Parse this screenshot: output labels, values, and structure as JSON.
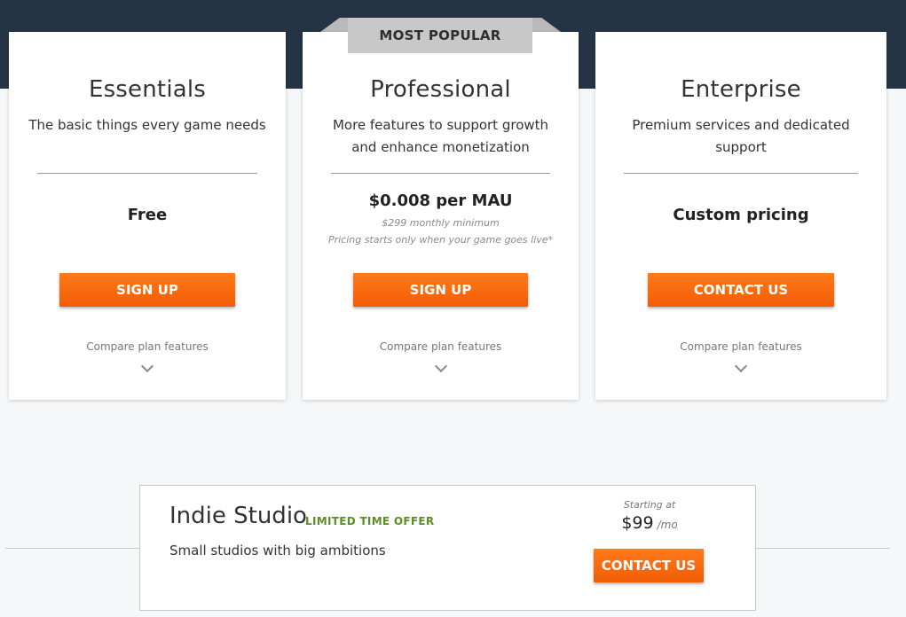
{
  "ribbon": {
    "label": "MOST POPULAR"
  },
  "plans": [
    {
      "name": "Essentials",
      "description": "The basic things every game needs",
      "price": "Free",
      "button_label": "SIGN UP",
      "compare_label": "Compare plan features"
    },
    {
      "name": "Professional",
      "description": "More features to support growth and enhance monetization",
      "price": "$0.008 per MAU",
      "price_note_1": "$299 monthly minimum",
      "price_note_2": "Pricing starts only when your game goes live*",
      "button_label": "SIGN UP",
      "compare_label": "Compare plan features"
    },
    {
      "name": "Enterprise",
      "description": "Premium services and dedicated support",
      "price": "Custom pricing",
      "button_label": "CONTACT US",
      "compare_label": "Compare plan features"
    }
  ],
  "indie": {
    "title": "Indie Studio",
    "offer": "LIMITED TIME OFFER",
    "description": "Small studios with big ambitions",
    "starting_label": "Starting at",
    "price": "$99",
    "period": "/mo",
    "button_label": "CONTACT US"
  },
  "icons": {
    "expand": "chevron-down-icon"
  },
  "colors": {
    "header_bg": "#253444",
    "button_orange": "#f25c05",
    "offer_green": "#5b8f22",
    "ribbon_gray": "#c8c8c8"
  }
}
